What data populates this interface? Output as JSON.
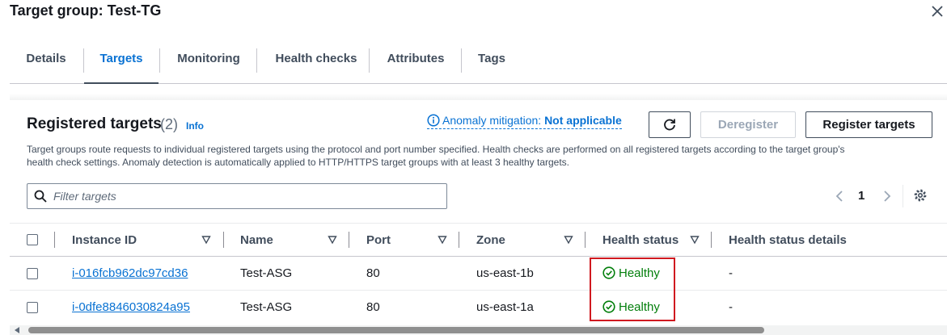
{
  "page": {
    "title": "Target group: Test-TG",
    "close_icon": "close-icon"
  },
  "tabs": [
    {
      "label": "Details",
      "active": false
    },
    {
      "label": "Targets",
      "active": true
    },
    {
      "label": "Monitoring",
      "active": false
    },
    {
      "label": "Health checks",
      "active": false
    },
    {
      "label": "Attributes",
      "active": false
    },
    {
      "label": "Tags",
      "active": false
    }
  ],
  "registered_targets": {
    "title": "Registered targets",
    "count": "(2)",
    "info_link": "Info",
    "anomaly_label": "Anomaly mitigation:",
    "anomaly_value": "Not applicable",
    "description_line1": "Target groups route requests to individual registered targets using the protocol and port number specified. Health checks are performed on all registered targets according to the target group's",
    "description_line2": "health check settings. Anomaly detection is automatically applied to HTTP/HTTPS target groups with at least 3 healthy targets.",
    "buttons": {
      "refresh_icon": "refresh-icon",
      "deregister": "Deregister",
      "register": "Register targets"
    },
    "search_placeholder": "Filter targets",
    "pagination": {
      "current_page": "1"
    }
  },
  "table": {
    "columns": [
      "Instance ID",
      "Name",
      "Port",
      "Zone",
      "Health status",
      "Health status details"
    ],
    "rows": [
      {
        "instance_id": "i-016fcb962dc97cd36",
        "name": "Test-ASG",
        "port": "80",
        "zone": "us-east-1b",
        "health_status": "Healthy",
        "health_details": "-"
      },
      {
        "instance_id": "i-0dfe8846030824a95",
        "name": "Test-ASG",
        "port": "80",
        "zone": "us-east-1a",
        "health_status": "Healthy",
        "health_details": "-"
      }
    ]
  },
  "colors": {
    "link_blue": "#0972d3",
    "healthy_green": "#037f0c",
    "highlight_red": "#d0191f"
  }
}
